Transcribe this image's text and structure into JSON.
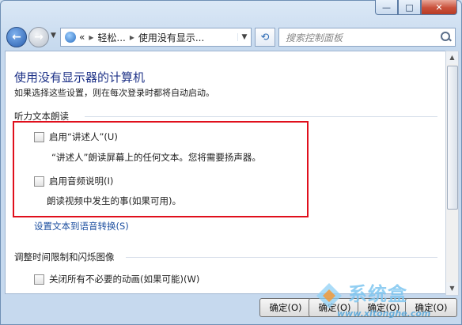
{
  "window": {
    "minimize": "—",
    "maximize": "□",
    "close": "✕"
  },
  "nav": {
    "back_glyph": "←",
    "forward_glyph": "→",
    "history_glyph": "▼",
    "breadcrumb_prefix": "«",
    "breadcrumb_1": "轻松...",
    "breadcrumb_2": "使用没有显示...",
    "sep_glyph": "▸",
    "dropdown_glyph": "▼",
    "refresh_glyph": "⟲"
  },
  "search": {
    "placeholder": "搜索控制面板"
  },
  "content": {
    "title": "使用没有显示器的计算机",
    "subtitle": "如果选择这些设置，则在每次登录时都将自动启动。",
    "section_listen": "听力文本朗读",
    "narrator_label": "启用“讲述人”(U)",
    "narrator_desc": "“讲述人”朗读屏幕上的任何文本。您将需要扬声器。",
    "audio_desc_label": "启用音频说明(I)",
    "audio_desc_desc": "朗读视频中发生的事(如果可用)。",
    "tts_link": "设置文本到语音转换(S)",
    "section_timing": "调整时间限制和闪烁图像",
    "animations_label": "关闭所有不必要的动画(如果可能)(W)"
  },
  "buttons": [
    {
      "label": "确定(O)"
    },
    {
      "label": "确定(O)"
    },
    {
      "label": "确定(O)"
    },
    {
      "label": "确定(O)"
    }
  ],
  "watermark": {
    "site": "系统盒",
    "url": "www.xitonghe.com"
  },
  "colors": {
    "highlight": "#e00f1c",
    "title": "#1e3287",
    "link": "#1e50a0"
  }
}
